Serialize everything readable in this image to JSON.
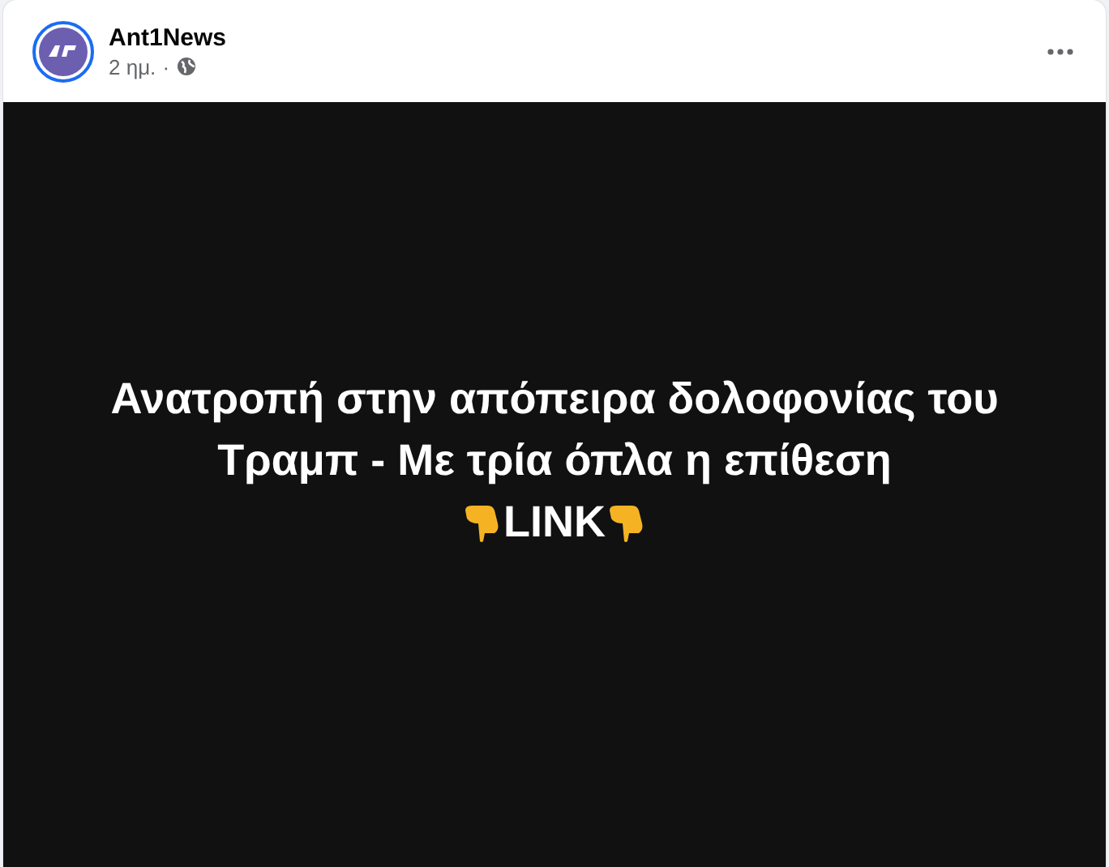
{
  "post": {
    "author": "Ant1News",
    "time": "2 ημ.",
    "separator": "·",
    "body": {
      "lines": [
        "Ανατροπή στην απόπειρα δολοφονίας του",
        "Τραμπ - Με τρία όπλα η επίθεση"
      ],
      "link": "LINK"
    }
  }
}
